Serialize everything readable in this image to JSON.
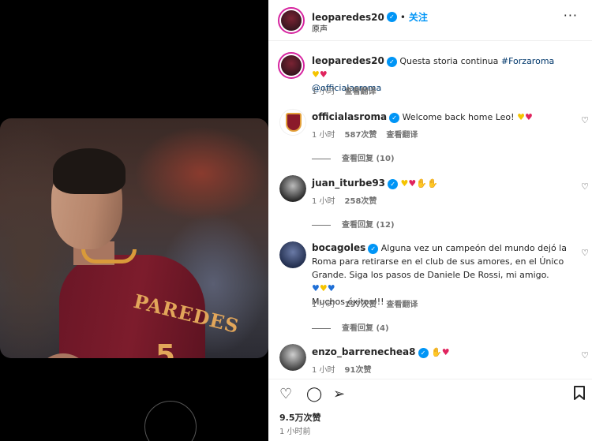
{
  "post": {
    "author": "leoparedes20",
    "follow_label": "关注",
    "audio_label": "原声",
    "more": "···",
    "caption": {
      "username": "leoparedes20",
      "text": "Questa storia continua",
      "hashtag": "#Forzaroma",
      "mention": "@officialasroma",
      "time": "1 小时",
      "translate": "查看翻译"
    },
    "likes": "9.5万次赞",
    "posted": "1 小时前",
    "shirt_name": "PAREDES",
    "shirt_number": "5"
  },
  "comments": [
    {
      "username": "officialasroma",
      "text": "Welcome back home Leo!",
      "time": "1 小时",
      "likes": "587次赞",
      "translate": "查看翻译",
      "replies": "查看回复 (10)"
    },
    {
      "username": "juan_iturbe93",
      "text": "",
      "time": "1 小时",
      "likes": "258次赞",
      "replies": "查看回复 (12)"
    },
    {
      "username": "bocagoles",
      "text": "Alguna vez un campeón del mundo dejó la Roma para retirarse en el club de sus amores, en el Único Grande. Siga los pasos de Daniele De Rossi, mi amigo.",
      "text2": "Muchos éxitos!!!",
      "time": "1 小时",
      "likes": "197次赞",
      "translate": "查看翻译",
      "replies": "查看回复 (4)"
    },
    {
      "username": "enzo_barrenechea8",
      "text": "",
      "time": "1 小时",
      "likes": "91次赞"
    }
  ],
  "icons": {
    "heart": "heart-icon",
    "comment": "comment-icon",
    "share": "share-icon",
    "save": "bookmark-icon"
  },
  "colors": {
    "link": "#00376b",
    "follow": "#0095f6",
    "verified": "#0095f6",
    "muted": "#737373"
  }
}
